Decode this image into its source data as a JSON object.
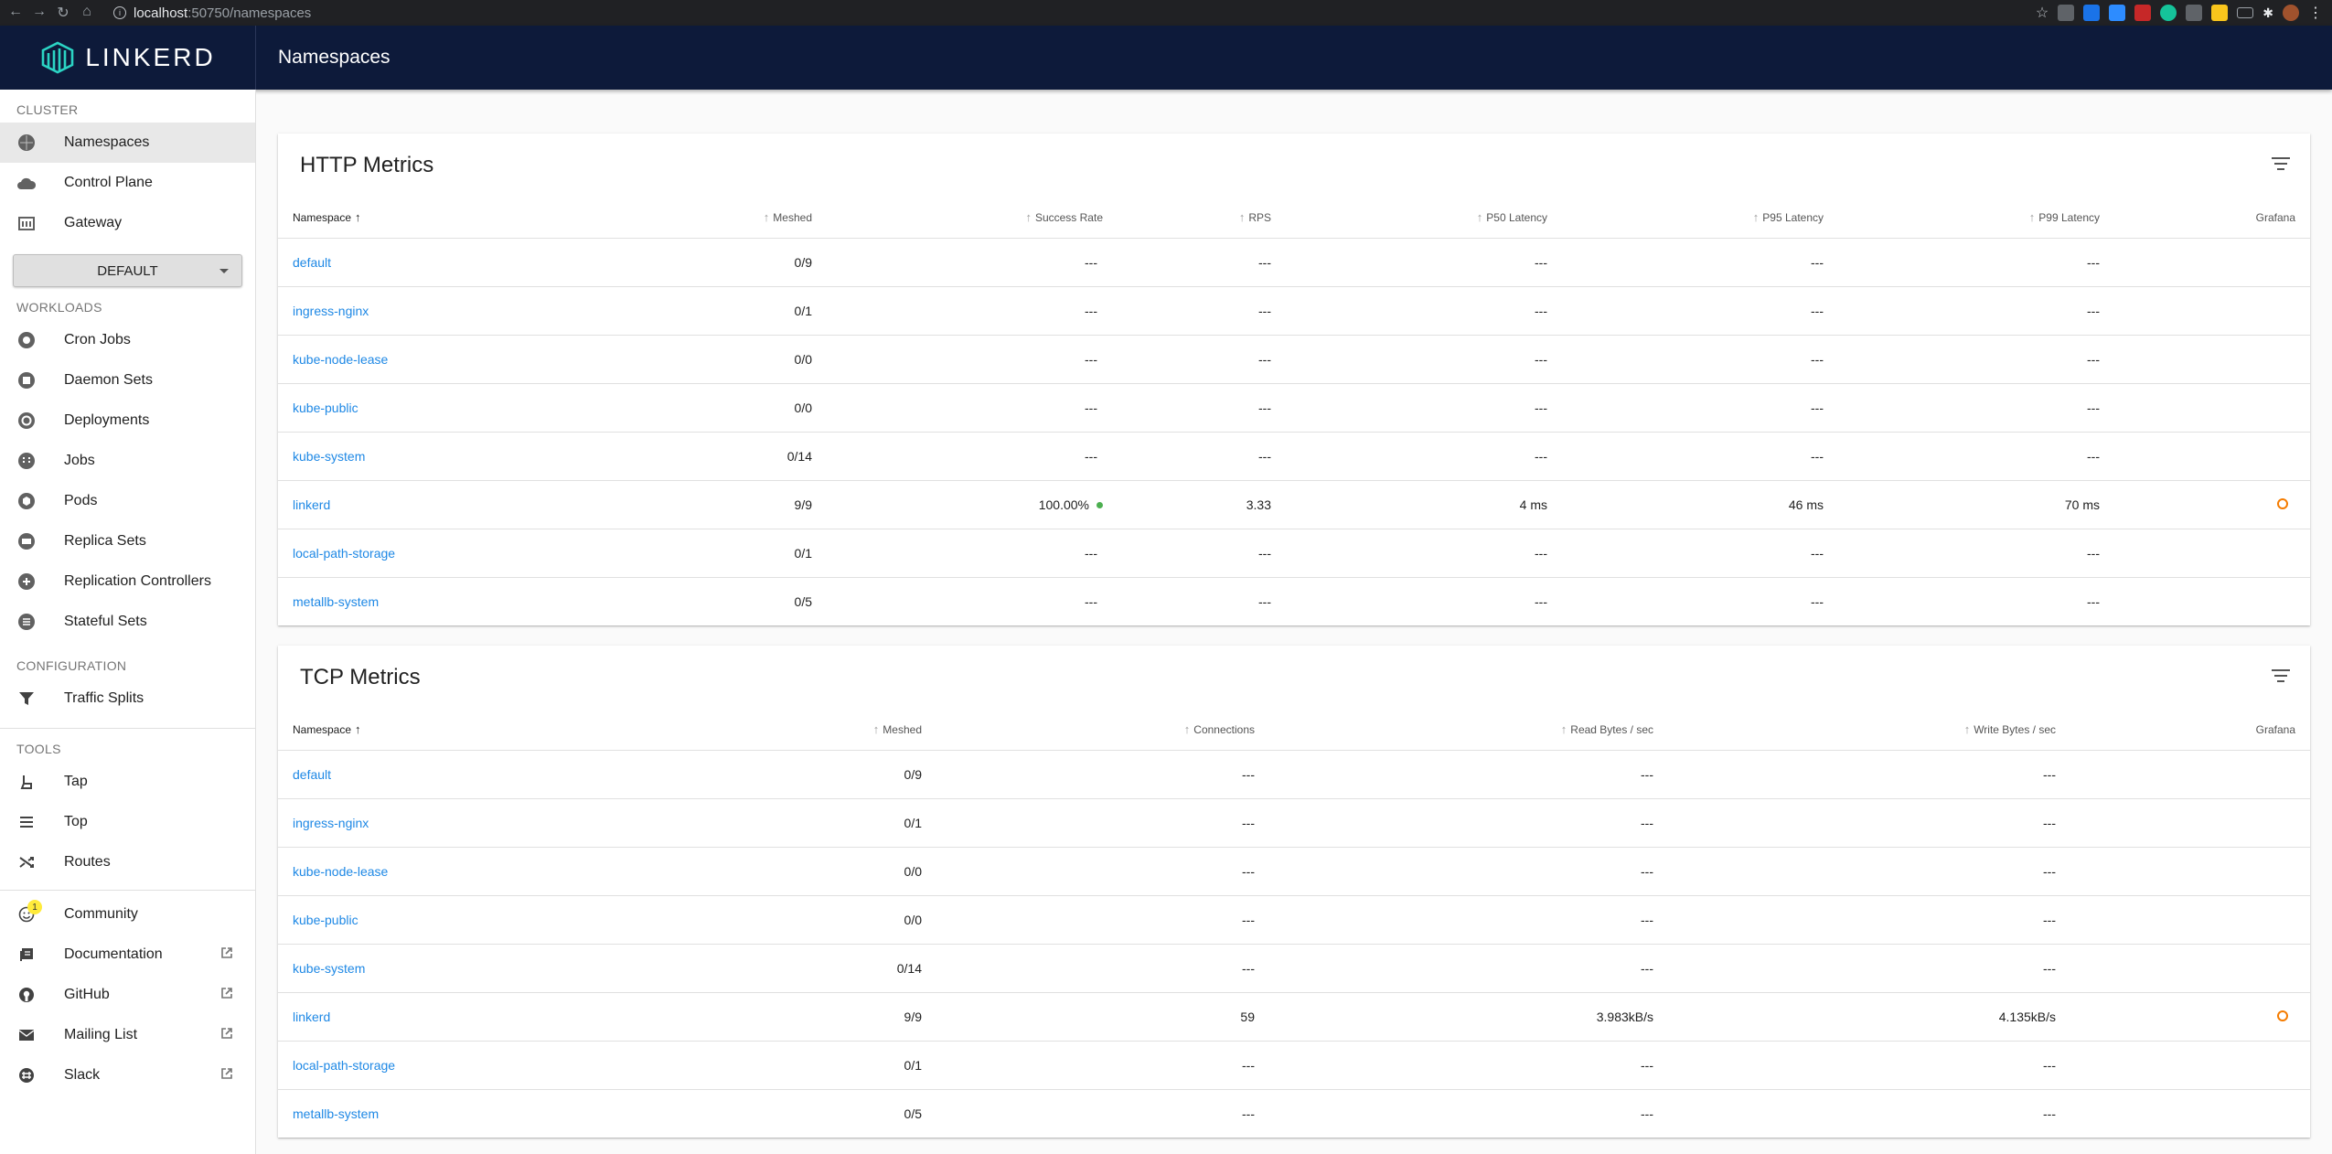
{
  "browser": {
    "url_host": "localhost",
    "url_path": ":50750/namespaces"
  },
  "app": {
    "brand": "LINKERD",
    "page_title": "Namespaces"
  },
  "sidebar": {
    "cluster_label": "CLUSTER",
    "cluster_items": [
      {
        "label": "Namespaces",
        "icon": "namespaces-icon"
      },
      {
        "label": "Control Plane",
        "icon": "cloud-icon"
      },
      {
        "label": "Gateway",
        "icon": "gateway-icon"
      }
    ],
    "namespace_select": "DEFAULT",
    "workloads_label": "WORKLOADS",
    "workload_items": [
      {
        "label": "Cron Jobs"
      },
      {
        "label": "Daemon Sets"
      },
      {
        "label": "Deployments"
      },
      {
        "label": "Jobs"
      },
      {
        "label": "Pods"
      },
      {
        "label": "Replica Sets"
      },
      {
        "label": "Replication Controllers"
      },
      {
        "label": "Stateful Sets"
      }
    ],
    "configuration_label": "CONFIGURATION",
    "configuration_items": [
      {
        "label": "Traffic Splits"
      }
    ],
    "tools_label": "TOOLS",
    "tools_items": [
      {
        "label": "Tap"
      },
      {
        "label": "Top"
      },
      {
        "label": "Routes"
      }
    ],
    "community": {
      "label": "Community",
      "badge": "1"
    },
    "external_items": [
      {
        "label": "Documentation"
      },
      {
        "label": "GitHub"
      },
      {
        "label": "Mailing List"
      },
      {
        "label": "Slack"
      }
    ]
  },
  "http_metrics": {
    "title": "HTTP Metrics",
    "columns": [
      "Namespace",
      "Meshed",
      "Success Rate",
      "RPS",
      "P50 Latency",
      "P95 Latency",
      "P99 Latency",
      "Grafana"
    ],
    "rows": [
      {
        "namespace": "default",
        "meshed": "0/9",
        "success_rate": "---",
        "rps": "---",
        "p50": "---",
        "p95": "---",
        "p99": "---",
        "grafana": false
      },
      {
        "namespace": "ingress-nginx",
        "meshed": "0/1",
        "success_rate": "---",
        "rps": "---",
        "p50": "---",
        "p95": "---",
        "p99": "---",
        "grafana": false
      },
      {
        "namespace": "kube-node-lease",
        "meshed": "0/0",
        "success_rate": "---",
        "rps": "---",
        "p50": "---",
        "p95": "---",
        "p99": "---",
        "grafana": false
      },
      {
        "namespace": "kube-public",
        "meshed": "0/0",
        "success_rate": "---",
        "rps": "---",
        "p50": "---",
        "p95": "---",
        "p99": "---",
        "grafana": false
      },
      {
        "namespace": "kube-system",
        "meshed": "0/14",
        "success_rate": "---",
        "rps": "---",
        "p50": "---",
        "p95": "---",
        "p99": "---",
        "grafana": false
      },
      {
        "namespace": "linkerd",
        "meshed": "9/9",
        "success_rate": "100.00%",
        "rps": "3.33",
        "p50": "4 ms",
        "p95": "46 ms",
        "p99": "70 ms",
        "grafana": true
      },
      {
        "namespace": "local-path-storage",
        "meshed": "0/1",
        "success_rate": "---",
        "rps": "---",
        "p50": "---",
        "p95": "---",
        "p99": "---",
        "grafana": false
      },
      {
        "namespace": "metallb-system",
        "meshed": "0/5",
        "success_rate": "---",
        "rps": "---",
        "p50": "---",
        "p95": "---",
        "p99": "---",
        "grafana": false
      }
    ]
  },
  "tcp_metrics": {
    "title": "TCP Metrics",
    "columns": [
      "Namespace",
      "Meshed",
      "Connections",
      "Read Bytes / sec",
      "Write Bytes / sec",
      "Grafana"
    ],
    "rows": [
      {
        "namespace": "default",
        "meshed": "0/9",
        "connections": "---",
        "read": "---",
        "write": "---",
        "grafana": false
      },
      {
        "namespace": "ingress-nginx",
        "meshed": "0/1",
        "connections": "---",
        "read": "---",
        "write": "---",
        "grafana": false
      },
      {
        "namespace": "kube-node-lease",
        "meshed": "0/0",
        "connections": "---",
        "read": "---",
        "write": "---",
        "grafana": false
      },
      {
        "namespace": "kube-public",
        "meshed": "0/0",
        "connections": "---",
        "read": "---",
        "write": "---",
        "grafana": false
      },
      {
        "namespace": "kube-system",
        "meshed": "0/14",
        "connections": "---",
        "read": "---",
        "write": "---",
        "grafana": false
      },
      {
        "namespace": "linkerd",
        "meshed": "9/9",
        "connections": "59",
        "read": "3.983kB/s",
        "write": "4.135kB/s",
        "grafana": true
      },
      {
        "namespace": "local-path-storage",
        "meshed": "0/1",
        "connections": "---",
        "read": "---",
        "write": "---",
        "grafana": false
      },
      {
        "namespace": "metallb-system",
        "meshed": "0/5",
        "connections": "---",
        "read": "---",
        "write": "---",
        "grafana": false
      }
    ]
  },
  "colors": {
    "appbar": "#0d1a3a",
    "link": "#1e88e5",
    "success": "#4caf50",
    "grafana": "#f57c00"
  }
}
